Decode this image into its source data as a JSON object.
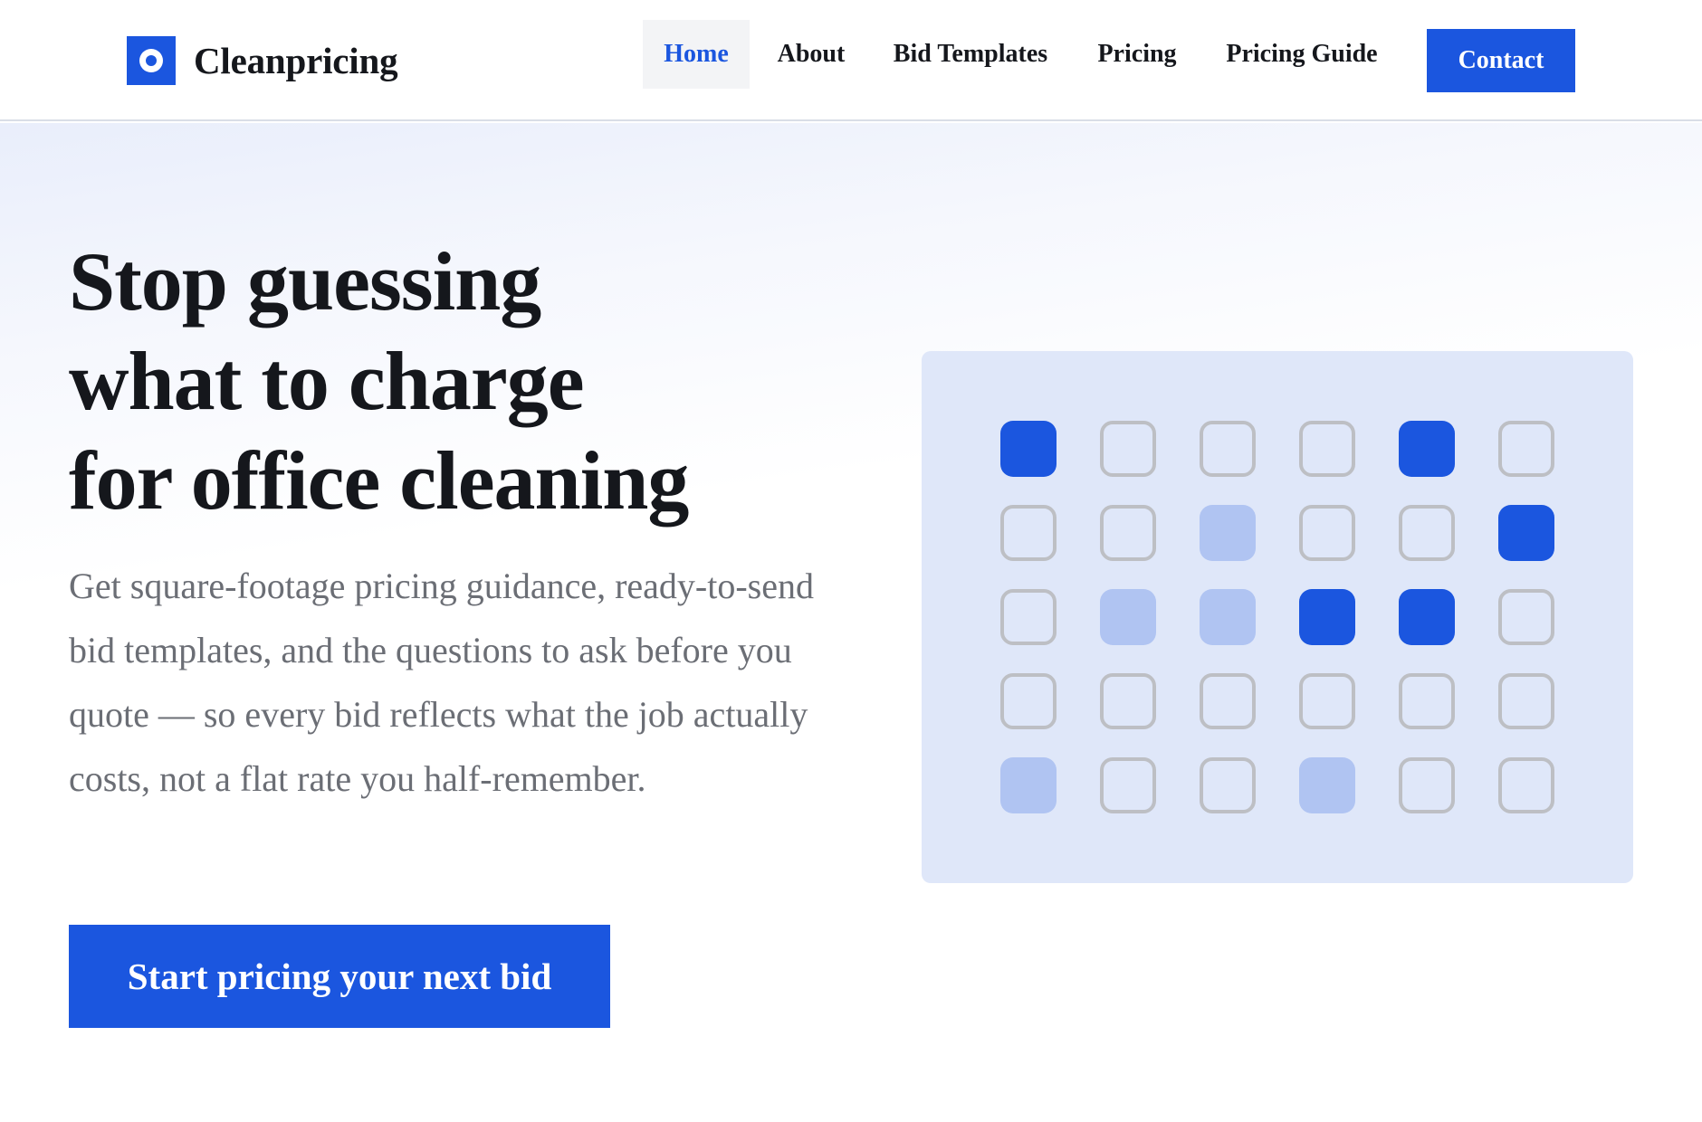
{
  "brand": {
    "name": "Cleanpricing",
    "icon": "brand-logo-icon",
    "accent": "#1b56df"
  },
  "nav": {
    "items": [
      {
        "label": "Home",
        "active": true
      },
      {
        "label": "About",
        "active": false
      },
      {
        "label": "Bid Templates",
        "active": false
      },
      {
        "label": "Pricing",
        "active": false
      },
      {
        "label": "Pricing Guide",
        "active": false
      }
    ],
    "contact_label": "Contact"
  },
  "hero": {
    "headline_lines": [
      "Stop guessing",
      "what to charge",
      "for office cleaning"
    ],
    "lede": "Get square-footage pricing guidance, ready-to-send bid templates, and the questions to ask before you quote — so every bid reflects what the job actually costs, not a flat rate you half-remember.",
    "cta_label": "Start pricing your next bid"
  },
  "illustration": {
    "grid": [
      [
        "dark",
        "empty",
        "empty",
        "empty",
        "dark",
        "empty"
      ],
      [
        "empty",
        "empty",
        "light",
        "empty",
        "empty",
        "dark"
      ],
      [
        "empty",
        "light",
        "light",
        "dark",
        "dark",
        "empty"
      ],
      [
        "empty",
        "empty",
        "empty",
        "empty",
        "empty",
        "empty"
      ],
      [
        "light",
        "empty",
        "empty",
        "light",
        "empty",
        "empty"
      ]
    ],
    "colors": {
      "dark": "#1b56df",
      "light": "#b0c4f2",
      "empty_border": "#bdbfc4",
      "panel": "#dfe7f9"
    }
  }
}
